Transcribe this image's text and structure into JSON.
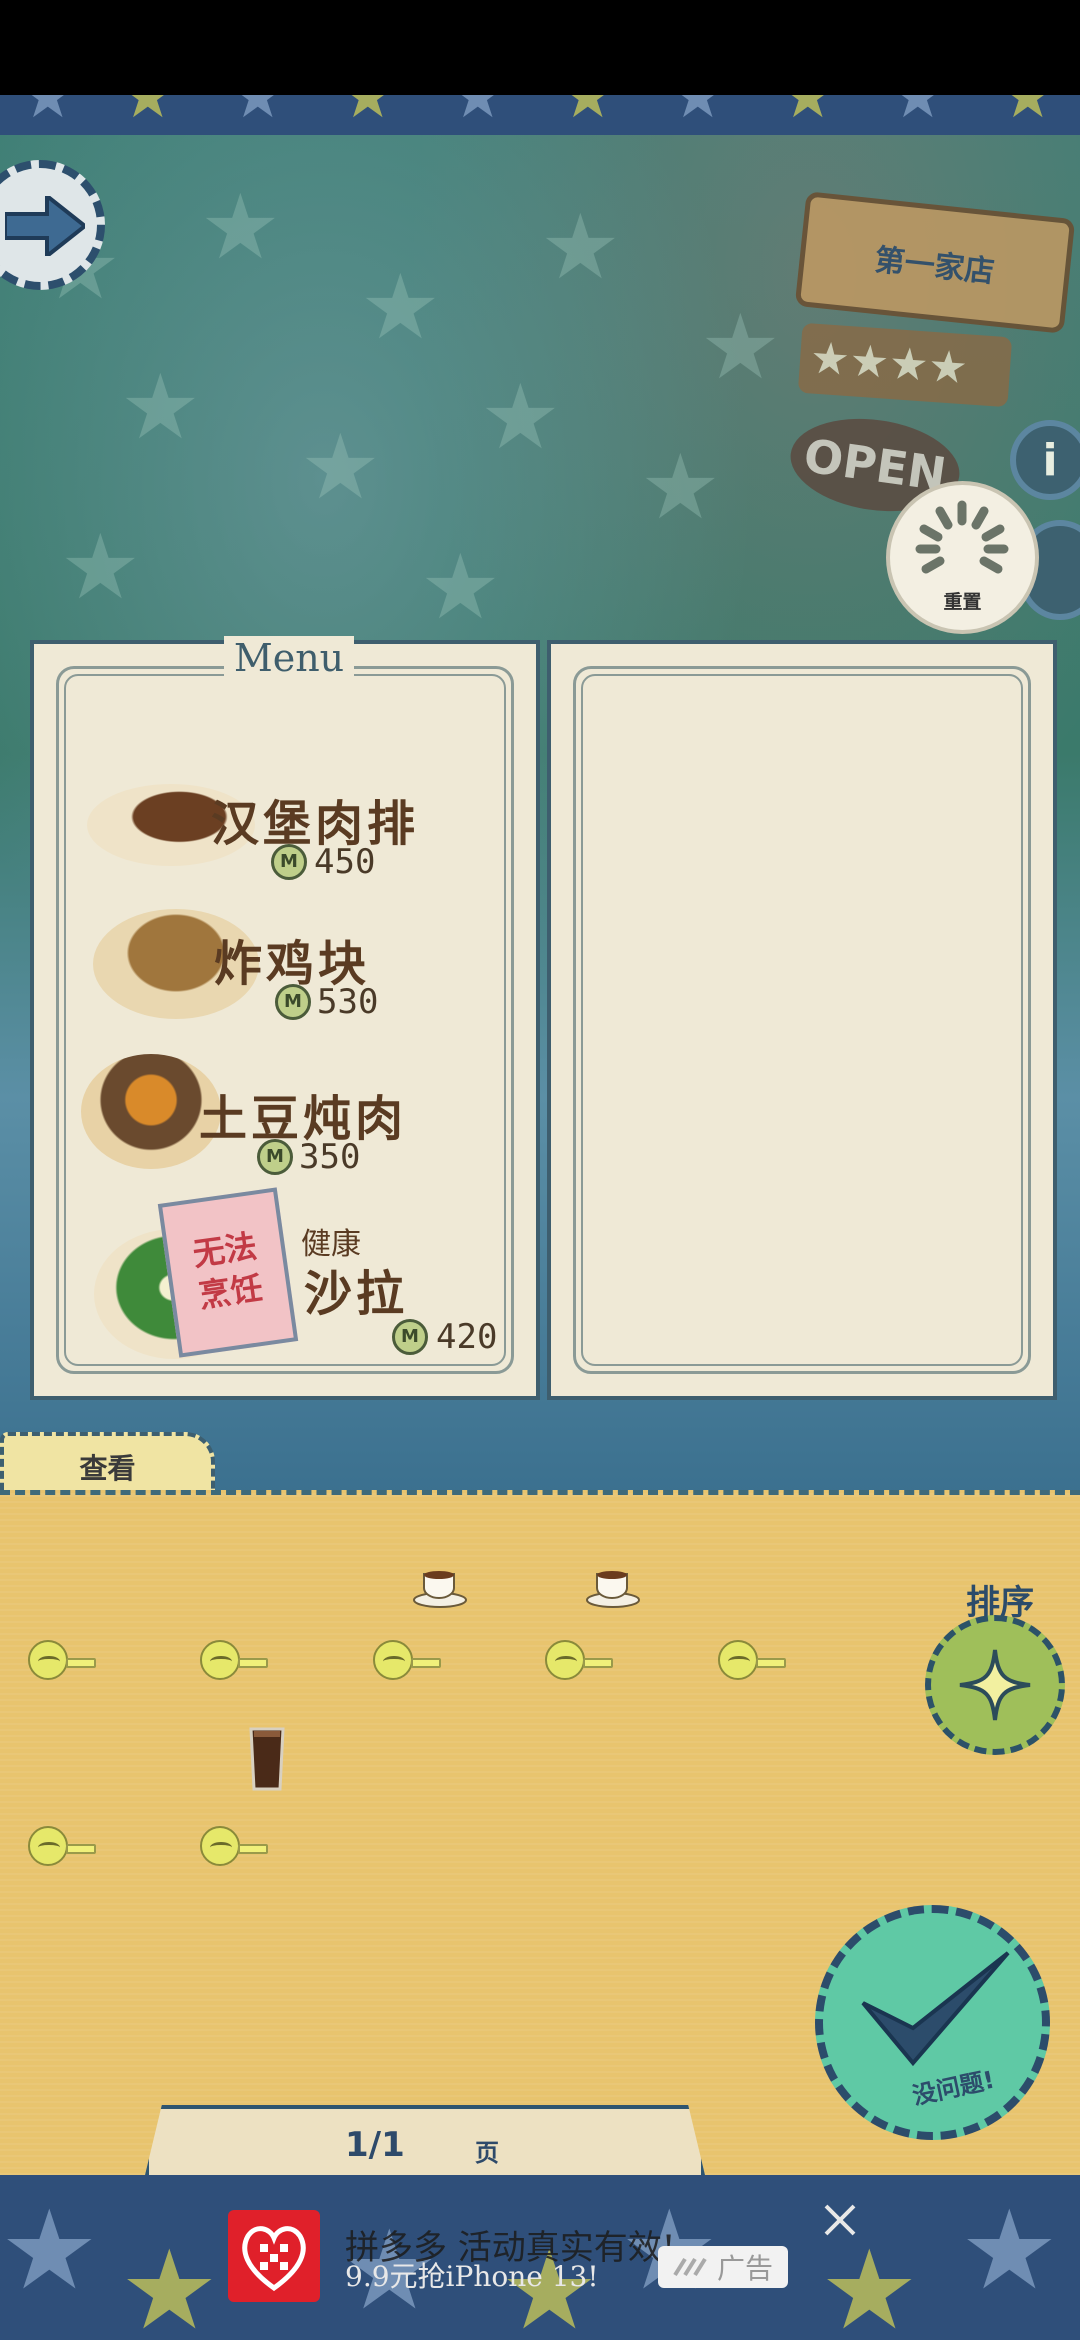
{
  "menu": {
    "title": "Menu",
    "items": [
      {
        "name": "汉堡肉排",
        "price": "450",
        "coin": "M"
      },
      {
        "name": "炸鸡块",
        "price": "530",
        "coin": "M"
      },
      {
        "name": "土豆炖肉",
        "price": "350",
        "coin": "M"
      },
      {
        "name_prefix": "健康",
        "name": "沙拉",
        "price": "420",
        "coin": "M",
        "status": "无法烹饪"
      }
    ]
  },
  "shop": {
    "sign": "第一家店",
    "open": "OPEN",
    "info": "i"
  },
  "reset_label": "重置",
  "view_tab": "查看",
  "sort_label": "排序",
  "confirm_label": "没问题!",
  "pagination": {
    "current": "1/1",
    "unit": "页"
  },
  "ad": {
    "title": "拼多多 活动真实有效!",
    "subtitle": "9.9元抢iPhone 13!",
    "badge": "广告"
  },
  "colors": {
    "board": "#e8c46e",
    "panel": "#efe9d6",
    "accent_blue": "#2e4a6a",
    "cannot_cook": "#c23a45"
  }
}
